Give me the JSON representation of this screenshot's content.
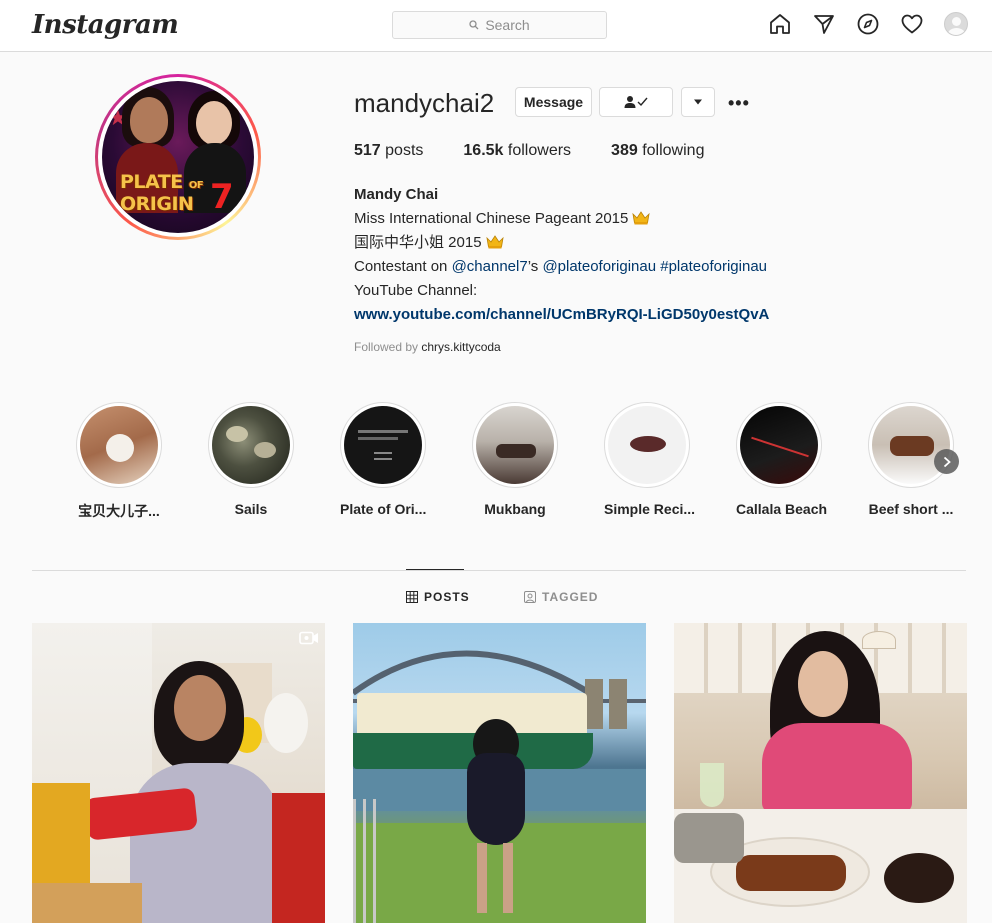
{
  "app": {
    "logo": "Instagram"
  },
  "search": {
    "placeholder": "Search"
  },
  "profile": {
    "username": "mandychai2",
    "buttons": {
      "message": "Message",
      "follow_icon": "person-check-icon",
      "dropdown_icon": "caret-down-icon",
      "more": "•••"
    },
    "counts": {
      "posts_value": "517",
      "posts_label": "posts",
      "followers_value": "16.5k",
      "followers_label": "followers",
      "following_value": "389",
      "following_label": "following"
    },
    "bio": {
      "name": "Mandy Chai",
      "line1": "Miss International Chinese Pageant 2015",
      "line2": "国际中华小姐 2015",
      "line3_prefix": "Contestant on ",
      "line3_link1": "@channel7",
      "line3_mid": "’s ",
      "line3_link2": "@plateoforiginau",
      "line3_sep": " ",
      "line3_link3": "#plateoforiginau",
      "line4": "YouTube Channel:",
      "url": "www.youtube.com/channel/UCmBRyRQI-LiGD50y0estQvA"
    },
    "followed_by_prefix": "Followed by",
    "followed_by_user": "chrys.kittycoda",
    "picture_text": {
      "title_line1": "PLATE",
      "title_of": "OF",
      "title_line2": "ORIGIN",
      "channel": "7"
    }
  },
  "highlights": [
    {
      "label": "宝贝大儿子..."
    },
    {
      "label": "Sails"
    },
    {
      "label": "Plate of Ori..."
    },
    {
      "label": "Mukbang"
    },
    {
      "label": "Simple Reci..."
    },
    {
      "label": "Callala Beach"
    },
    {
      "label": "Beef short ..."
    }
  ],
  "tabs": {
    "posts": "POSTS",
    "tagged": "TAGGED"
  },
  "colors": {
    "link": "#00376b",
    "border": "#dbdbdb",
    "muted": "#8e8e8e",
    "text": "#262626"
  }
}
